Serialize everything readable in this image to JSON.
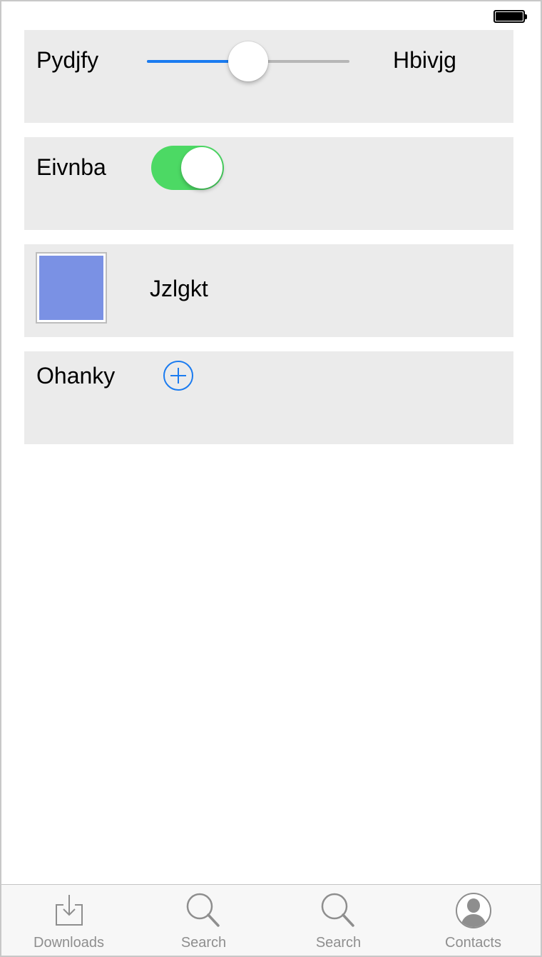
{
  "status_bar": {
    "battery_icon": "battery-icon"
  },
  "rows": {
    "slider_row": {
      "left_label": "Pydjfy",
      "right_label": "Hbivjg",
      "slider_value": 0.5
    },
    "switch_row": {
      "label": "Eivnba",
      "switch_on": true
    },
    "color_row": {
      "label": "Jzlgkt",
      "swatch_color": "#7a91e4"
    },
    "add_row": {
      "label": "Ohanky",
      "add_icon": "plus-circle-icon"
    }
  },
  "colors": {
    "accent": "#1a7bf0",
    "switch_on": "#4cd964",
    "cell_bg": "#ebebeb"
  },
  "tabbar": {
    "tabs": [
      {
        "label": "Downloads",
        "icon": "downloads-icon"
      },
      {
        "label": "Search",
        "icon": "search-icon"
      },
      {
        "label": "Search",
        "icon": "search-icon"
      },
      {
        "label": "Contacts",
        "icon": "contacts-icon"
      }
    ]
  }
}
